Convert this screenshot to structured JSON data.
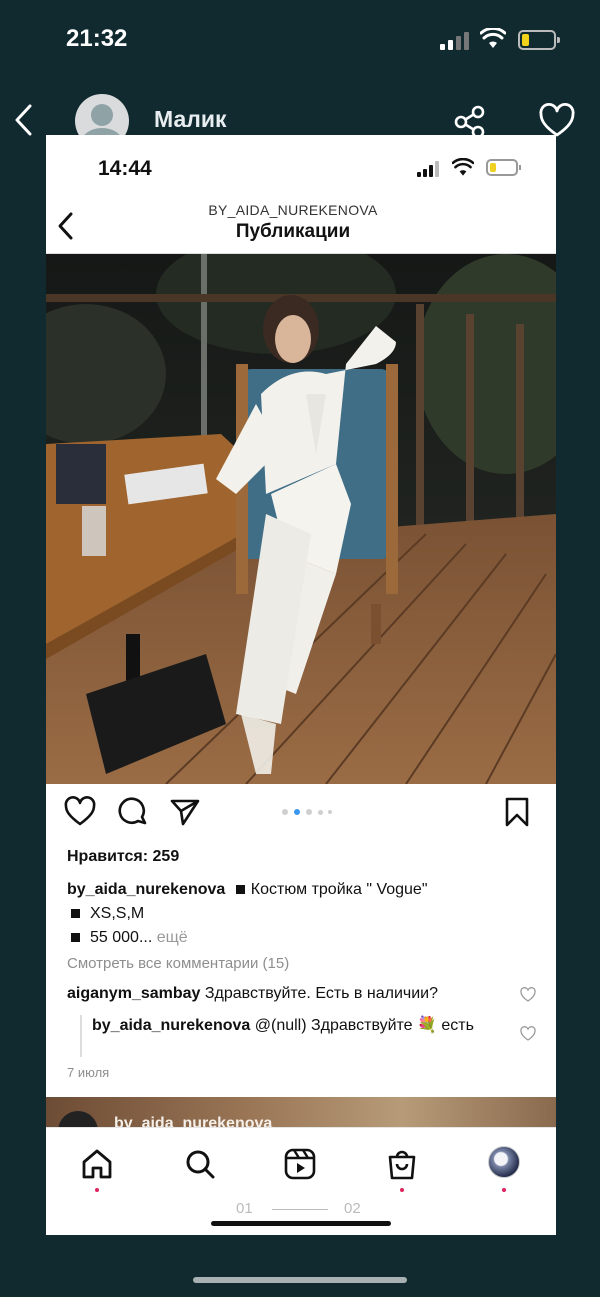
{
  "outer": {
    "time": "21:32",
    "contact_name": "Малик",
    "icons": [
      "back-chevron-icon",
      "avatar",
      "share-icon",
      "heart-icon"
    ]
  },
  "inner": {
    "time": "14:44",
    "account": "BY_AIDA_NUREKENOVA",
    "screen_title": "Публикации",
    "likes": "Нравится: 259",
    "caption": {
      "user": "by_aida_nurekenova",
      "text": "Костюм тройка \" Vogue\"",
      "line2": "XS,S,M",
      "line3": "55 000...",
      "more": " ещё"
    },
    "view_all": "Смотреть все комментарии (15)",
    "comment": {
      "user": "aiganym_sambay",
      "text": " Здравствуйте. Есть в наличии?"
    },
    "reply": {
      "user": "by_aida_nurekenova",
      "text": " @(null) Здравствуйте 💐 есть"
    },
    "date": "7 июля",
    "next_post_user": "by_aida_nurekenova",
    "page_indicator": {
      "left": "01",
      "right": "02"
    },
    "carousel_active_index": 1,
    "carousel_count": 5
  },
  "colors": {
    "outer_bg": "#102a30",
    "battery_yellow": "#f2d21b",
    "notification_dot": "#e0245e",
    "active_dot": "#3897f0"
  }
}
